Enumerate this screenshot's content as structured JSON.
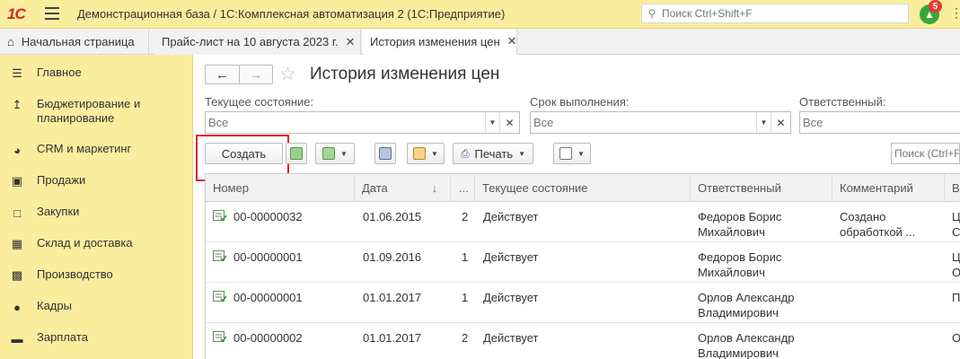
{
  "app": {
    "logo_text": "1С",
    "title": "Демонстрационная база / 1С:Комплексная автоматизация 2  (1С:Предприятие)",
    "search_placeholder": "Поиск Ctrl+Shift+F",
    "notifications_count": "5"
  },
  "tabs": [
    {
      "label": "Начальная страница"
    },
    {
      "label": "Прайс-лист на 10 августа 2023 г."
    },
    {
      "label": "История изменения цен"
    }
  ],
  "sidebar": {
    "items": [
      {
        "label": "Главное",
        "icon": "menu-lines-icon"
      },
      {
        "label": "Бюджетирование и планирование",
        "icon": "budget-chart-icon"
      },
      {
        "label": "CRM и маркетинг",
        "icon": "pie-chart-icon"
      },
      {
        "label": "Продажи",
        "icon": "shopping-bag-icon"
      },
      {
        "label": "Закупки",
        "icon": "shopping-cart-icon"
      },
      {
        "label": "Склад и доставка",
        "icon": "warehouse-grid-icon"
      },
      {
        "label": "Производство",
        "icon": "factory-icon"
      },
      {
        "label": "Кадры",
        "icon": "person-icon"
      },
      {
        "label": "Зарплата",
        "icon": "salary-icon"
      }
    ]
  },
  "page": {
    "title": "История изменения цен"
  },
  "filters": {
    "state": {
      "label": "Текущее состояние:",
      "placeholder": "Все"
    },
    "deadline": {
      "label": "Срок выполнения:",
      "placeholder": "Все"
    },
    "responsible": {
      "label": "Ответственный:",
      "placeholder": "Все"
    }
  },
  "toolbar": {
    "create_label": "Создать",
    "print_label": "Печать",
    "search_placeholder": "Поиск (Ctrl+F)"
  },
  "table": {
    "columns": [
      "Номер",
      "Дата",
      "...",
      "Текущее состояние",
      "Ответственный",
      "Комментарий",
      "В"
    ],
    "rows": [
      {
        "number": "00-00000032",
        "date": "01.06.2015",
        "n": "2",
        "state": "Действует",
        "resp1": "Федоров Борис",
        "resp2": "Михайлович",
        "comm1": "Создано",
        "comm2": "обработкой ...",
        "v1": "Ц",
        "v2": "С"
      },
      {
        "number": "00-00000001",
        "date": "01.09.2016",
        "n": "1",
        "state": "Действует",
        "resp1": "Федоров Борис",
        "resp2": "Михайлович",
        "comm1": "",
        "comm2": "",
        "v1": "Ц",
        "v2": "О"
      },
      {
        "number": "00-00000001",
        "date": "01.01.2017",
        "n": "1",
        "state": "Действует",
        "resp1": "Орлов Александр",
        "resp2": "Владимирович",
        "comm1": "",
        "comm2": "",
        "v1": "П",
        "v2": ""
      },
      {
        "number": "00-00000002",
        "date": "01.01.2017",
        "n": "2",
        "state": "Действует",
        "resp1": "Орлов Александр",
        "resp2": "Владимирович",
        "comm1": "",
        "comm2": "",
        "v1": "О",
        "v2": ""
      }
    ]
  },
  "colors": {
    "panel_yellow": "#fbed9e",
    "highlight_red": "#e31b23",
    "logo_red": "#d7242b",
    "notify_green": "#3aa536"
  }
}
